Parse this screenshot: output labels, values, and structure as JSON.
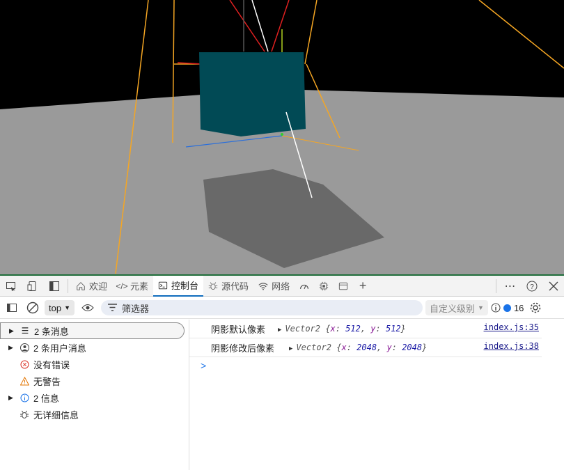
{
  "toolbar": {
    "tabs": [
      {
        "label": "欢迎",
        "icon": "home-icon"
      },
      {
        "label": "元素",
        "icon": "code-icon"
      },
      {
        "label": "控制台",
        "icon": "console-icon"
      },
      {
        "label": "源代码",
        "icon": "bug-icon"
      },
      {
        "label": "网络",
        "icon": "wifi-icon"
      },
      {
        "label": "",
        "icon": "performance-icon"
      },
      {
        "label": "",
        "icon": "memory-chip-icon"
      },
      {
        "label": "",
        "icon": "application-icon"
      }
    ],
    "active_tab": "控制台"
  },
  "filterbar": {
    "context": "top",
    "filter_placeholder": "筛选器",
    "level": "自定义级别",
    "issue_count": "16"
  },
  "sidebar": {
    "items": [
      {
        "label": "2 条消息",
        "icon": "list-icon",
        "expandable": true
      },
      {
        "label": "2 条用户消息",
        "icon": "user-circle-icon",
        "expandable": true
      },
      {
        "label": "没有错误",
        "icon": "error-icon",
        "expandable": false
      },
      {
        "label": "无警告",
        "icon": "warning-icon",
        "expandable": false
      },
      {
        "label": "2 信息",
        "icon": "info-icon",
        "expandable": true
      },
      {
        "label": "无详细信息",
        "icon": "bug-icon",
        "expandable": false
      }
    ]
  },
  "console": {
    "logs": [
      {
        "label": "阴影默认像素",
        "type": "Vector2",
        "x": "512",
        "y": "512",
        "source": "index.js:35"
      },
      {
        "label": "阴影修改后像素",
        "type": "Vector2",
        "x": "2048",
        "y": "2048",
        "source": "index.js:38"
      }
    ],
    "prompt": ">"
  },
  "colors": {
    "accent": "#0f6cbd",
    "cube": "#014a55",
    "floor": "#9a9a9a",
    "shadow": "#696969"
  }
}
